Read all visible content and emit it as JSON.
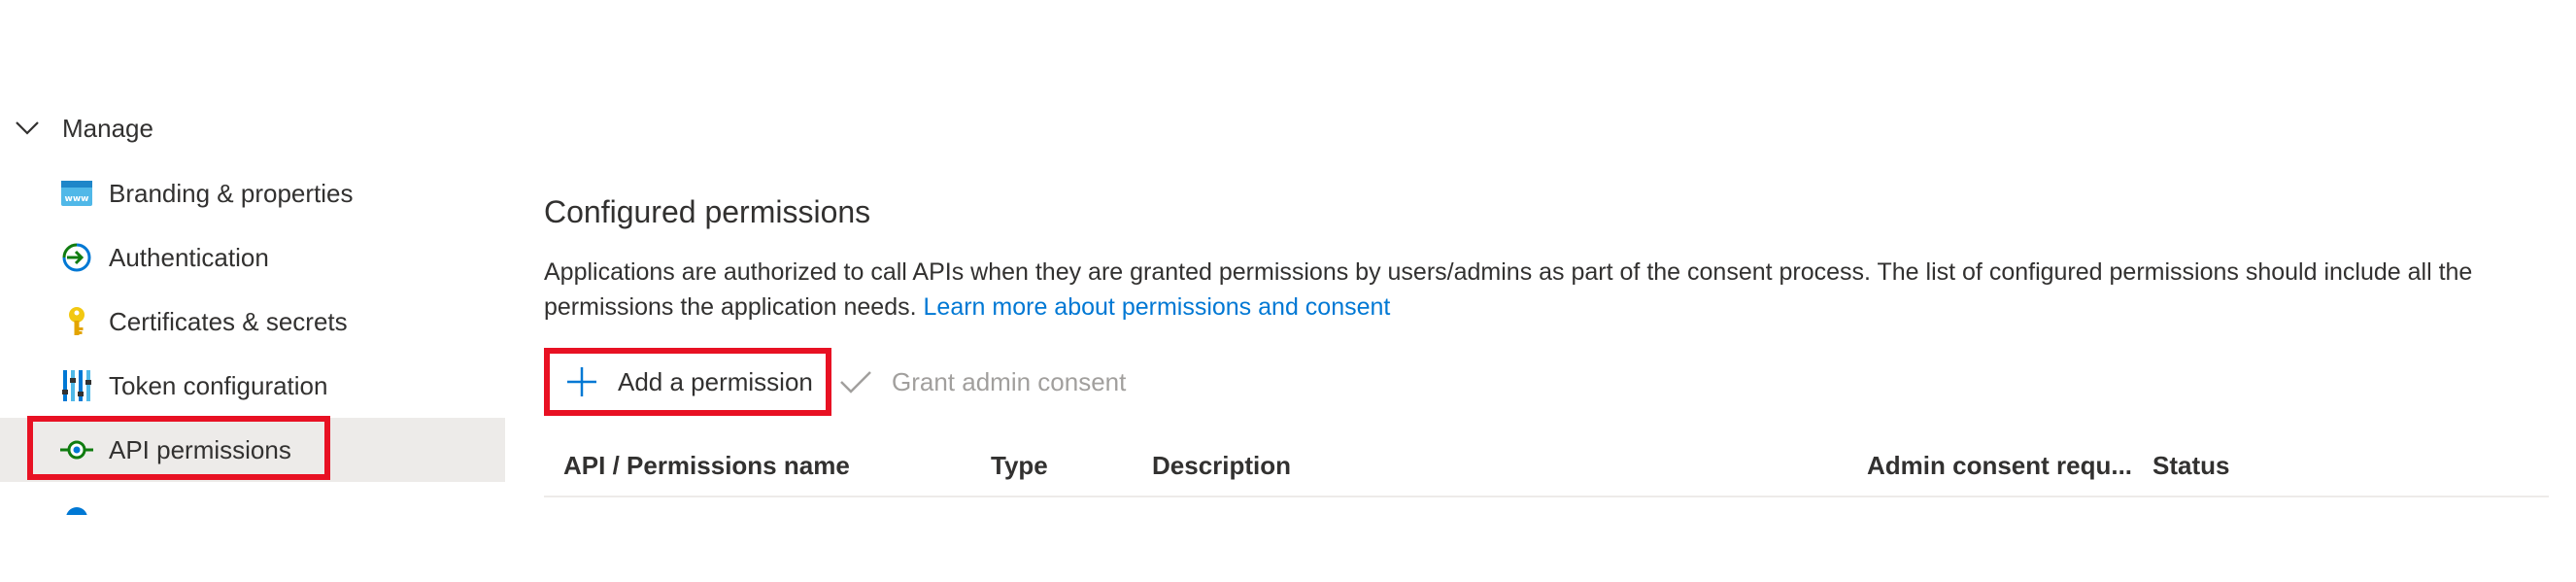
{
  "sidebar": {
    "group_label": "Manage",
    "items": [
      {
        "label": "Branding & properties",
        "icon": "branding-icon",
        "selected": false
      },
      {
        "label": "Authentication",
        "icon": "authentication-icon",
        "selected": false
      },
      {
        "label": "Certificates & secrets",
        "icon": "key-icon",
        "selected": false
      },
      {
        "label": "Token configuration",
        "icon": "token-configuration-icon",
        "selected": false
      },
      {
        "label": "API permissions",
        "icon": "api-permissions-icon",
        "selected": true
      }
    ]
  },
  "main": {
    "title": "Configured permissions",
    "description": "Applications are authorized to call APIs when they are granted permissions by users/admins as part of the consent process. The list of configured permissions should include all the permissions the application needs.",
    "learn_more_link": "Learn more about permissions and consent",
    "toolbar": {
      "add_permission": "Add a permission",
      "grant_admin_consent": "Grant admin consent"
    },
    "table": {
      "columns": [
        "API / Permissions name",
        "Type",
        "Description",
        "Admin consent requ...",
        "Status"
      ]
    }
  },
  "colors": {
    "accent": "#0078d4",
    "highlight": "#e81123",
    "selected_bg": "#edebe9",
    "disabled_text": "#a19f9d"
  }
}
